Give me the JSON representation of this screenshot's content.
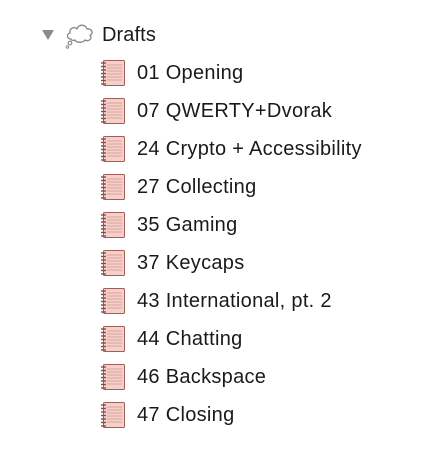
{
  "binder": {
    "folder": {
      "label": "Drafts",
      "expanded": true,
      "disclosure_icon": "triangle-down-icon",
      "icon": "drafts-cloud-icon"
    },
    "documents": [
      {
        "label": "01 Opening",
        "icon": "document-icon"
      },
      {
        "label": "07 QWERTY+Dvorak",
        "icon": "document-icon"
      },
      {
        "label": "24 Crypto + Accessibility",
        "icon": "document-icon"
      },
      {
        "label": "27 Collecting",
        "icon": "document-icon"
      },
      {
        "label": "35 Gaming",
        "icon": "document-icon"
      },
      {
        "label": "37 Keycaps",
        "icon": "document-icon"
      },
      {
        "label": "43 International, pt. 2",
        "icon": "document-icon"
      },
      {
        "label": "44 Chatting",
        "icon": "document-icon"
      },
      {
        "label": "46 Backspace",
        "icon": "document-icon"
      },
      {
        "label": "47 Closing",
        "icon": "document-icon"
      }
    ]
  },
  "colors": {
    "doc_page_fill": "#f6cfca",
    "doc_page_stroke": "#a06058",
    "doc_binding": "#8a4a44",
    "disclosure": "#8b8b8b",
    "cloud_stroke": "#8a8a8a"
  }
}
